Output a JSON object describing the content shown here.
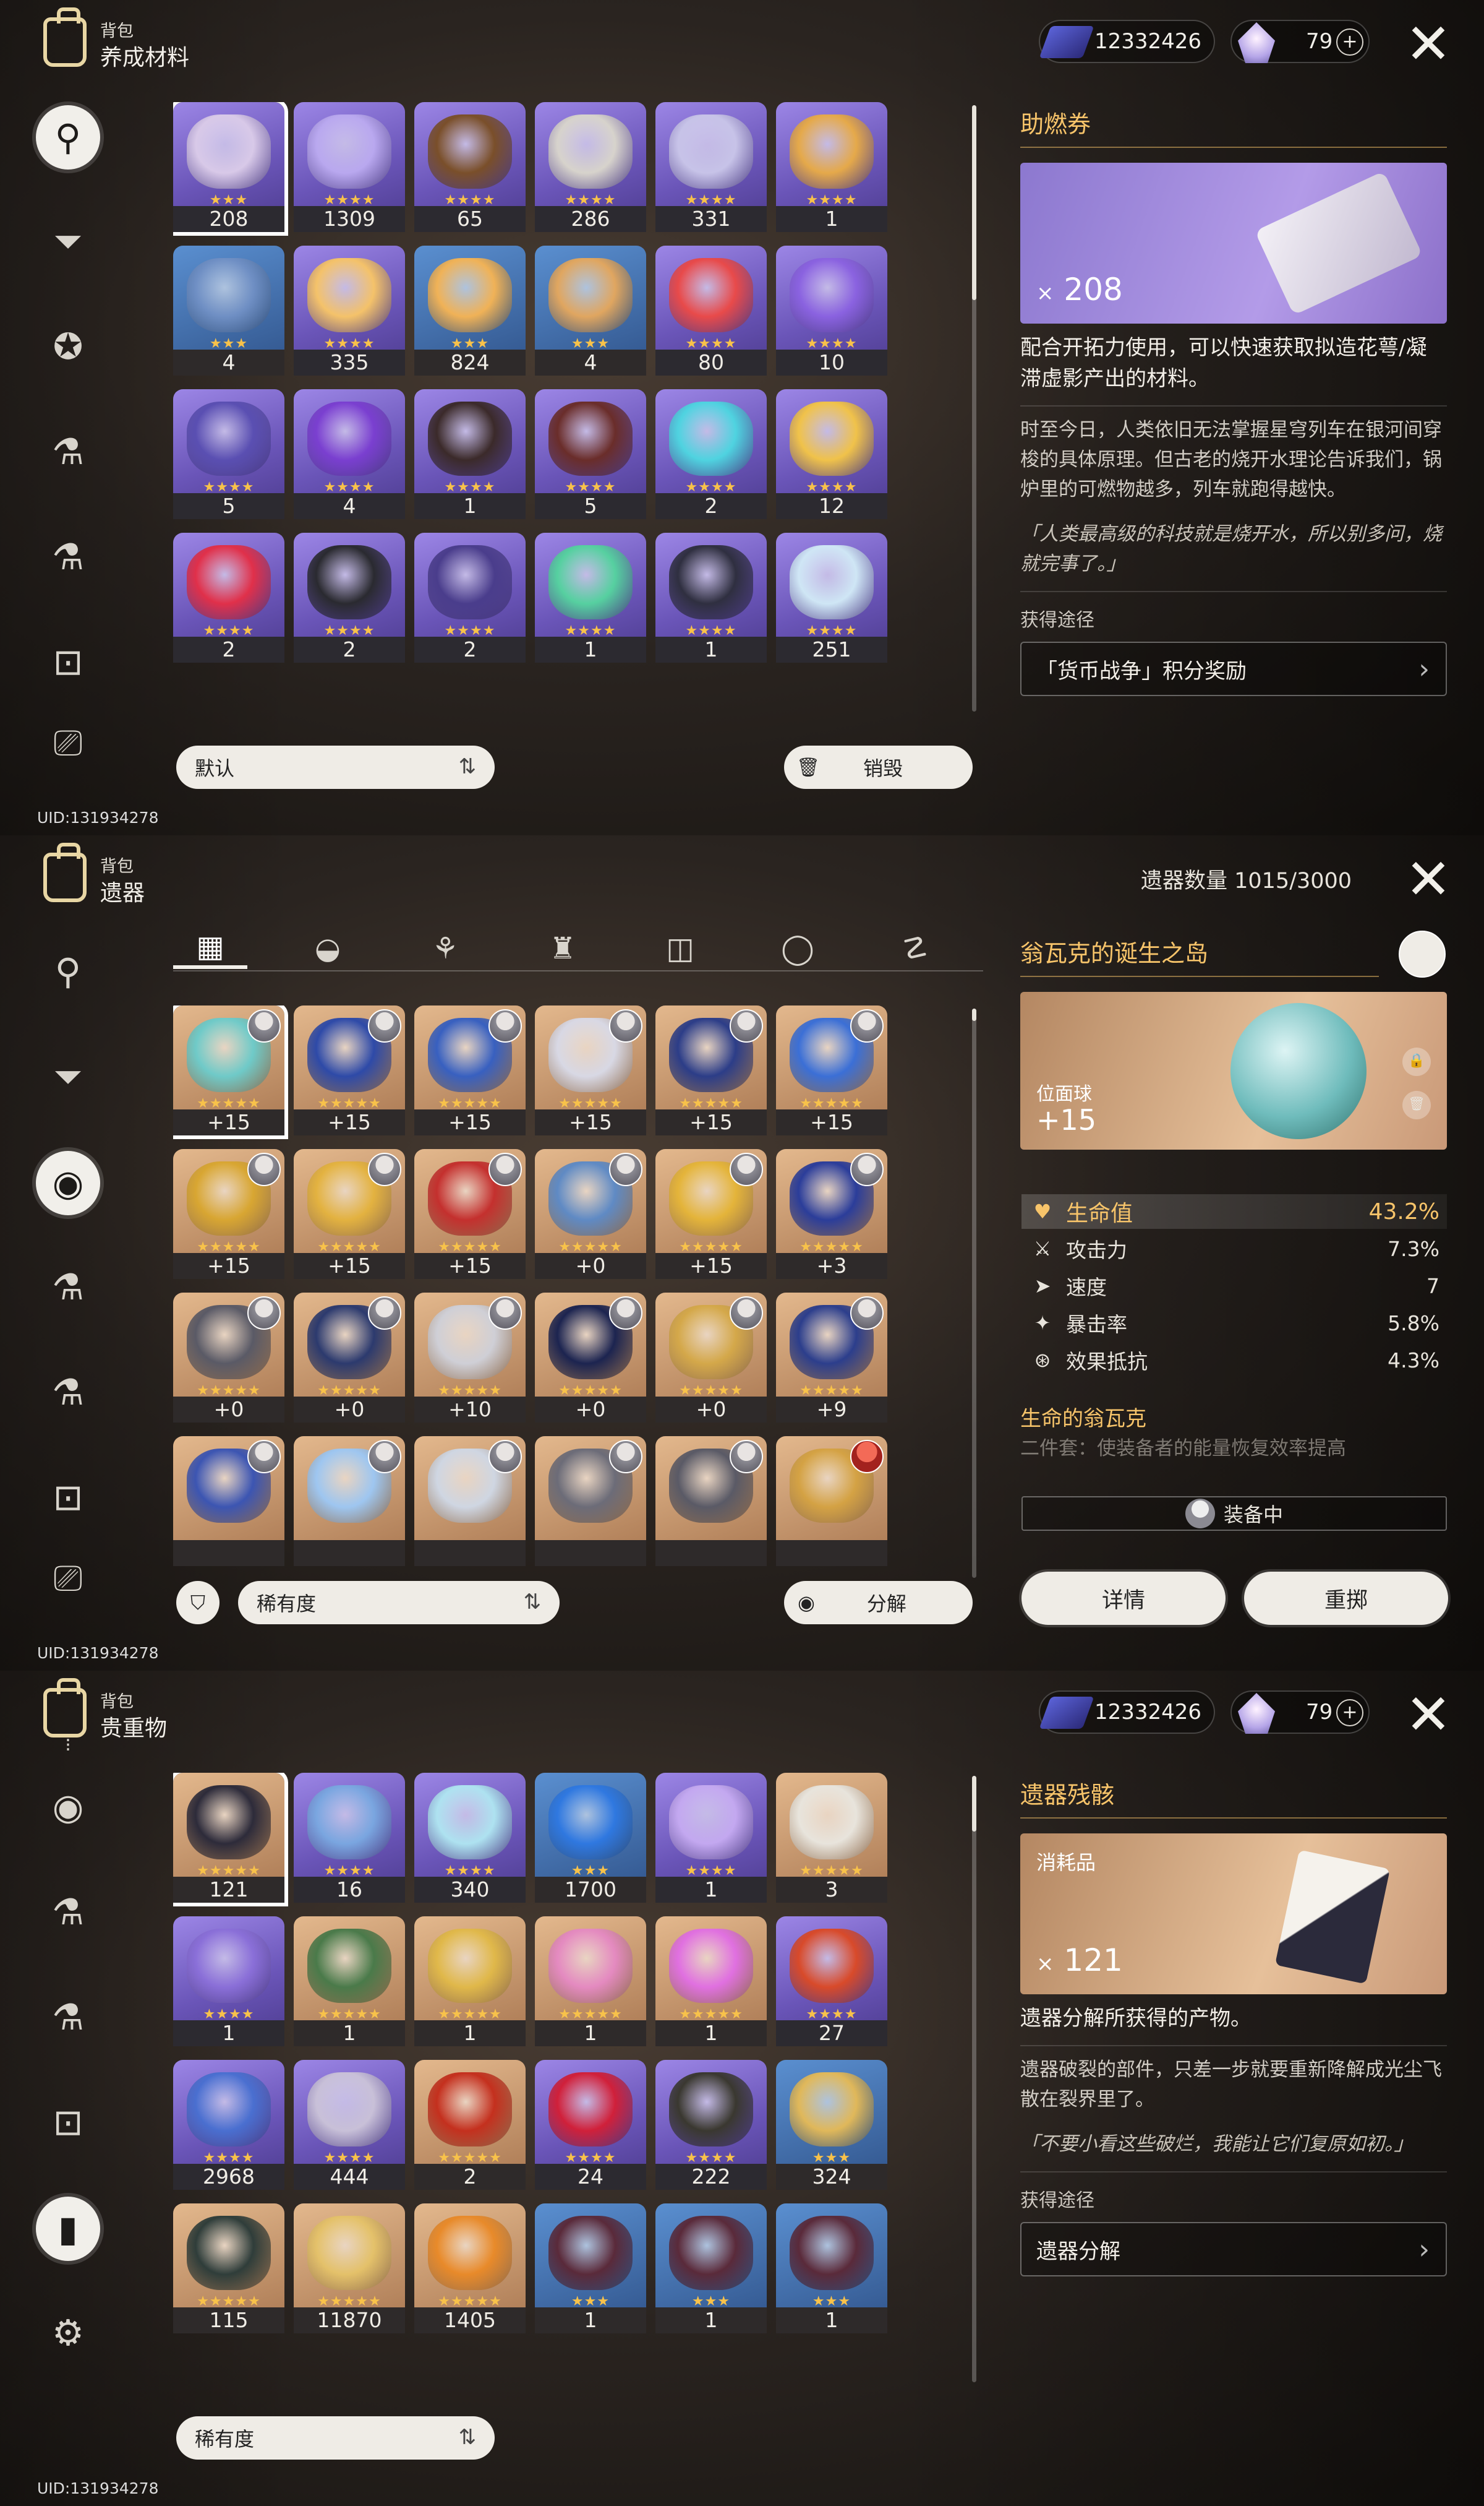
{
  "uid": "UID:131934278",
  "bag_label": "背包",
  "currency": {
    "stellar_jade": "12332426",
    "fuel": "79",
    "plus": "+"
  },
  "close_glyph": "✕",
  "panel1": {
    "category": "养成材料",
    "items": [
      {
        "count": "208",
        "stars": "★★★",
        "color": "purple",
        "art": "#d8c9e8",
        "selected": true
      },
      {
        "count": "1309",
        "stars": "★★★★",
        "color": "purple",
        "art": "#b9a8ef"
      },
      {
        "count": "65",
        "stars": "★★★★",
        "color": "purple",
        "art": "#7a4f2a"
      },
      {
        "count": "286",
        "stars": "★★★★",
        "color": "purple",
        "art": "#d7d3cc"
      },
      {
        "count": "331",
        "stars": "★★★★",
        "color": "purple",
        "art": "#c7c3e8"
      },
      {
        "count": "1",
        "stars": "★★★★",
        "color": "purple",
        "art": "#e5a94a"
      },
      {
        "count": "4",
        "stars": "★★★",
        "color": "blue",
        "art": "#6f8fc4"
      },
      {
        "count": "335",
        "stars": "★★★★",
        "color": "purple",
        "art": "#f4c26a"
      },
      {
        "count": "824",
        "stars": "★★★",
        "color": "blue",
        "art": "#f0b257"
      },
      {
        "count": "4",
        "stars": "★★★",
        "color": "blue",
        "art": "#e0a660"
      },
      {
        "count": "80",
        "stars": "★★★★",
        "color": "purple",
        "art": "#e84a4a"
      },
      {
        "count": "10",
        "stars": "★★★★",
        "color": "purple",
        "art": "#8a62e0"
      },
      {
        "count": "5",
        "stars": "★★★★",
        "color": "purple",
        "art": "#5a4fb2"
      },
      {
        "count": "4",
        "stars": "★★★★",
        "color": "purple",
        "art": "#7a3fd0"
      },
      {
        "count": "1",
        "stars": "★★★★",
        "color": "purple",
        "art": "#3b2a2a"
      },
      {
        "count": "5",
        "stars": "★★★★",
        "color": "purple",
        "art": "#6a2d2a"
      },
      {
        "count": "2",
        "stars": "★★★★",
        "color": "purple",
        "art": "#4fd3e0"
      },
      {
        "count": "12",
        "stars": "★★★★",
        "color": "purple",
        "art": "#f0c24a"
      },
      {
        "count": "2",
        "stars": "★★★★",
        "color": "purple",
        "art": "#e0304a"
      },
      {
        "count": "2",
        "stars": "★★★★",
        "color": "purple",
        "art": "#2a2a30"
      },
      {
        "count": "2",
        "stars": "★★★★",
        "color": "purple",
        "art": "#4a3d8c"
      },
      {
        "count": "1",
        "stars": "★★★★",
        "color": "purple",
        "art": "#56d0a0"
      },
      {
        "count": "1",
        "stars": "★★★★",
        "color": "purple",
        "art": "#2f2f40"
      },
      {
        "count": "251",
        "stars": "★★★★",
        "color": "purple",
        "art": "#cfe6f5"
      }
    ],
    "sort_label": "默认",
    "sort_icon": "⇅",
    "destroy_label": "销毁",
    "destroy_icon": "🗑",
    "detail": {
      "title": "助燃券",
      "count_prefix": "×",
      "count": "208",
      "desc": "配合开拓力使用，可以快速获取拟造花萼/凝滞虚影产出的材料。",
      "lore": "时至今日，人类依旧无法掌握星穹列车在银河间穿梭的具体原理。但古老的烧开水理论告诉我们，锅炉里的可燃物越多，列车就跑得越快。",
      "quote": "「人类最高级的科技就是烧开水，所以别多问，烧就完事了。」",
      "source_label": "获得途径",
      "source": "「货币战争」积分奖励"
    }
  },
  "panel2": {
    "category": "遗器",
    "count_text": "遗器数量 1015/3000",
    "tabs": [
      "▦",
      "◒",
      "⚘",
      "♜",
      "◫",
      "◯",
      "☡"
    ],
    "items": [
      {
        "count": "+15",
        "stars": "★★★★★",
        "art": "#6fcac8",
        "selected": true
      },
      {
        "count": "+15",
        "stars": "★★★★★",
        "art": "#2e4aa8"
      },
      {
        "count": "+15",
        "stars": "★★★★★",
        "art": "#3860c0"
      },
      {
        "count": "+15",
        "stars": "★★★★★",
        "art": "#d8d8e4"
      },
      {
        "count": "+15",
        "stars": "★★★★★",
        "art": "#2c3d88"
      },
      {
        "count": "+15",
        "stars": "★★★★★",
        "art": "#3b6fd6"
      },
      {
        "count": "+15",
        "stars": "★★★★★",
        "art": "#d8a632"
      },
      {
        "count": "+15",
        "stars": "★★★★★",
        "art": "#e3b240"
      },
      {
        "count": "+15",
        "stars": "★★★★★",
        "art": "#c4302e"
      },
      {
        "count": "+0",
        "stars": "★★★★★",
        "art": "#5f8ac4"
      },
      {
        "count": "+15",
        "stars": "★★★★★",
        "art": "#e4b43a"
      },
      {
        "count": "+3",
        "stars": "★★★★★",
        "art": "#2b3d9a"
      },
      {
        "count": "+0",
        "stars": "★★★★★",
        "art": "#5a5a66"
      },
      {
        "count": "+0",
        "stars": "★★★★★",
        "art": "#2c3a6e"
      },
      {
        "count": "+10",
        "stars": "★★★★★",
        "art": "#cfcfd6"
      },
      {
        "count": "+0",
        "stars": "★★★★★",
        "art": "#1c2450"
      },
      {
        "count": "+0",
        "stars": "★★★★★",
        "art": "#d4a84a"
      },
      {
        "count": "+9",
        "stars": "★★★★★",
        "art": "#2c3e8c"
      },
      {
        "count": "",
        "stars": "",
        "art": "#3c55b2"
      },
      {
        "count": "",
        "stars": "",
        "art": "#9ec6f0"
      },
      {
        "count": "",
        "stars": "",
        "art": "#cfd6e2"
      },
      {
        "count": "",
        "stars": "",
        "art": "#6c6c78"
      },
      {
        "count": "",
        "stars": "",
        "art": "#5a5a66"
      },
      {
        "count": "",
        "stars": "",
        "art": "#d4a244",
        "red": true
      }
    ],
    "filter_icon": "⛉",
    "sort_label": "稀有度",
    "sort_icon": "⇅",
    "salvage_label": "分解",
    "salvage_icon": "◉",
    "detail": {
      "title": "翁瓦克的诞生之岛",
      "slot": "位面球",
      "level": "+15",
      "lock_icon": "🔒",
      "trash_icon": "🗑",
      "main_stat": {
        "label": "生命值",
        "value": "43.2%",
        "icon": "♥"
      },
      "sub_stats": [
        {
          "label": "攻击力",
          "value": "7.3%",
          "icon": "⚔"
        },
        {
          "label": "速度",
          "value": "7",
          "icon": "➤"
        },
        {
          "label": "暴击率",
          "value": "5.8%",
          "icon": "✦"
        },
        {
          "label": "效果抵抗",
          "value": "4.3%",
          "icon": "⊛"
        }
      ],
      "set_name": "生命的翁瓦克",
      "set_effect": "二件套：使装备者的能量恢复效率提高",
      "equipped_label": "装备中",
      "details_button": "详情",
      "reroll_button": "重掷"
    }
  },
  "panel3": {
    "category": "贵重物",
    "items": [
      {
        "count": "121",
        "stars": "★★★★★",
        "color": "orange",
        "art": "#2d2b3a",
        "selected": true
      },
      {
        "count": "16",
        "stars": "★★★★",
        "color": "purple",
        "art": "#7aa6e0"
      },
      {
        "count": "340",
        "stars": "★★★★",
        "color": "purple",
        "art": "#aee2f0"
      },
      {
        "count": "1700",
        "stars": "★★★",
        "color": "blue",
        "art": "#2f78e0"
      },
      {
        "count": "1",
        "stars": "★★★★",
        "color": "purple",
        "art": "#c3a8f0"
      },
      {
        "count": "3",
        "stars": "★★★★★",
        "color": "orange",
        "art": "#e8e4dc"
      },
      {
        "count": "1",
        "stars": "★★★★",
        "color": "purple",
        "art": "#8a6fd8"
      },
      {
        "count": "1",
        "stars": "★★★★★",
        "color": "orange",
        "art": "#4a7a4a"
      },
      {
        "count": "1",
        "stars": "★★★★★",
        "color": "orange",
        "art": "#e0b84a"
      },
      {
        "count": "1",
        "stars": "★★★★★",
        "color": "orange",
        "art": "#e48ac0"
      },
      {
        "count": "1",
        "stars": "★★★★★",
        "color": "orange",
        "art": "#e070e0"
      },
      {
        "count": "27",
        "stars": "★★★★",
        "color": "purple",
        "art": "#d84a2a"
      },
      {
        "count": "2968",
        "stars": "★★★★",
        "color": "purple",
        "art": "#4a6fd0"
      },
      {
        "count": "444",
        "stars": "★★★★",
        "color": "purple",
        "art": "#c8c0d8"
      },
      {
        "count": "2",
        "stars": "★★★★★",
        "color": "orange",
        "art": "#c4301e"
      },
      {
        "count": "24",
        "stars": "★★★★",
        "color": "purple",
        "art": "#d0203a"
      },
      {
        "count": "222",
        "stars": "★★★★",
        "color": "purple",
        "art": "#3a3830"
      },
      {
        "count": "324",
        "stars": "★★★",
        "color": "blue",
        "art": "#e0b85a"
      },
      {
        "count": "115",
        "stars": "★★★★★",
        "color": "orange",
        "art": "#2f3d3a"
      },
      {
        "count": "11870",
        "stars": "★★★★★",
        "color": "orange",
        "art": "#e4c16a"
      },
      {
        "count": "1405",
        "stars": "★★★★★",
        "color": "orange",
        "art": "#e88a2a"
      },
      {
        "count": "1",
        "stars": "★★★",
        "color": "blue",
        "art": "#5a2a3a"
      },
      {
        "count": "1",
        "stars": "★★★",
        "color": "blue",
        "art": "#5a2a3a"
      },
      {
        "count": "1",
        "stars": "★★★",
        "color": "blue",
        "art": "#5a2a3a"
      }
    ],
    "sort_label": "稀有度",
    "sort_icon": "⇅",
    "detail": {
      "title": "遗器残骸",
      "category": "消耗品",
      "count_prefix": "×",
      "count": "121",
      "desc": "遗器分解所获得的产物。",
      "lore": "遗器破裂的部件，只差一步就要重新降解成光尘飞散在裂界里了。",
      "quote": "「不要小看这些破烂，我能让它们复原如初。」",
      "source_label": "获得途径",
      "source": "遗器分解"
    }
  },
  "rail": {
    "icons1": [
      "⚲",
      "⏷",
      "✪",
      "⚗",
      "⚗",
      "⊡",
      "⎚"
    ],
    "icons2": [
      "⚲",
      "⏷",
      "◉",
      "⚗",
      "⚗",
      "⊡",
      "⎚"
    ],
    "icons3": [
      "⁝",
      "◉",
      "⚗",
      "⚗",
      "⊡",
      "▮",
      "⚙"
    ]
  }
}
